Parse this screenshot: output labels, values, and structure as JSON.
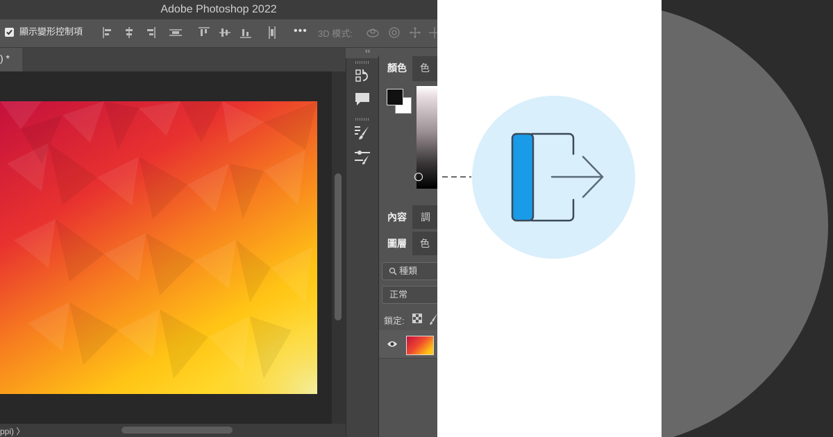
{
  "window": {
    "title": "Adobe Photoshop 2022"
  },
  "options_bar": {
    "show_transform_controls": "顯示變形控制項",
    "more": "•••",
    "mode_3d": "3D 模式:"
  },
  "document": {
    "tab_label": ") *",
    "status": "ppi)  〉"
  },
  "panels": {
    "color_tabs": [
      "顏色",
      "色票"
    ],
    "properties_tabs": [
      "內容",
      "調整"
    ],
    "layers_tabs": [
      "圖層",
      "色版"
    ],
    "search_placeholder": "種類",
    "blend_mode": "正常",
    "lock_label": "鎖定:"
  },
  "colors": {
    "gradient_top": "#c4103d",
    "gradient_mid": "#ef4a2e",
    "gradient_bottom": "#ffc415",
    "exit_icon_blue": "#1a9be8",
    "exit_circle_bg": "#d9effb"
  },
  "icons": {
    "exit": "exit-door-arrow-icon",
    "toolstrip": [
      "history-icon",
      "comment-icon",
      "brush-settings-icon",
      "adjustments-icon"
    ]
  }
}
